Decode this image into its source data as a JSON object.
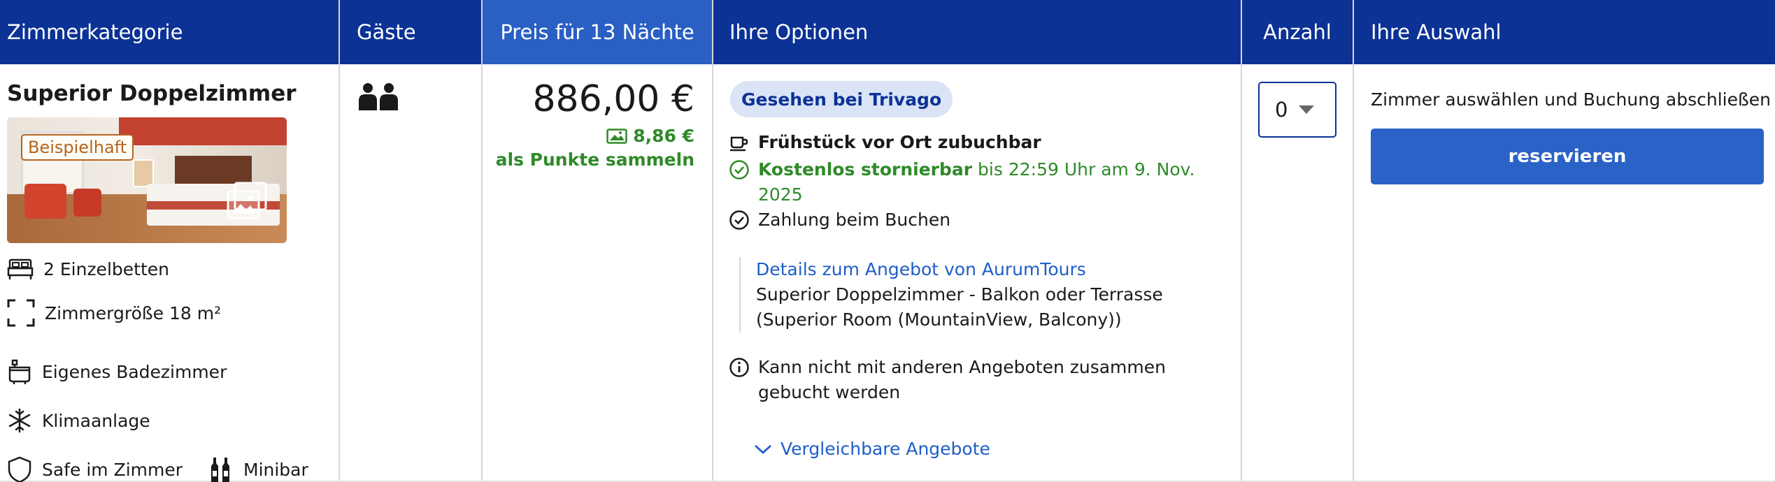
{
  "header": {
    "col_room": "Zimmerkategorie",
    "col_guests": "Gäste",
    "col_price": "Preis für 13 Nächte",
    "col_options": "Ihre Optionen",
    "col_count": "Anzahl",
    "col_choice": "Ihre Auswahl"
  },
  "room": {
    "title": "Superior Doppelzimmer",
    "image_badge": "Beispielhaft",
    "features": {
      "beds": "2 Einzelbetten",
      "size": "Zimmergröße 18 m²",
      "bathroom": "Eigenes Badezimmer",
      "ac": "Klimaanlage",
      "safe": "Safe im Zimmer",
      "minibar": "Minibar"
    }
  },
  "guests": {
    "count": 2,
    "icon": "two-persons-icon"
  },
  "price": {
    "total": "886,00 €",
    "points": "8,86 €",
    "points_label": "als Punkte sammeln",
    "accent_green": "#2f8a29"
  },
  "options": {
    "trivago_badge": "Gesehen bei Trivago",
    "breakfast": "Frühstück vor Ort zubuchbar",
    "cancellation_bold": "Kostenlos stornierbar",
    "cancellation_rest": " bis 22:59 Uhr am 9. Nov. 2025",
    "payment": "Zahlung beim Buchen",
    "details_link": "Details zum Angebot von AurumTours",
    "details_line1": "Superior Doppelzimmer - Balkon oder Terrasse",
    "details_line2": "(Superior Room (MountainView, Balcony))",
    "notice": "Kann nicht mit anderen Angeboten zusammen gebucht werden",
    "compare_link": "Vergleichbare Angebote"
  },
  "count": {
    "selected": "0"
  },
  "choice": {
    "text": "Zimmer auswählen und Buchung abschließen",
    "button": "reservieren"
  },
  "colors": {
    "header_bg": "#0c3295",
    "price_header_bg": "#2a5fc4",
    "button_bg": "#2a62c8",
    "link": "#1e5ec8",
    "badge_bg": "#dbe4f6"
  }
}
